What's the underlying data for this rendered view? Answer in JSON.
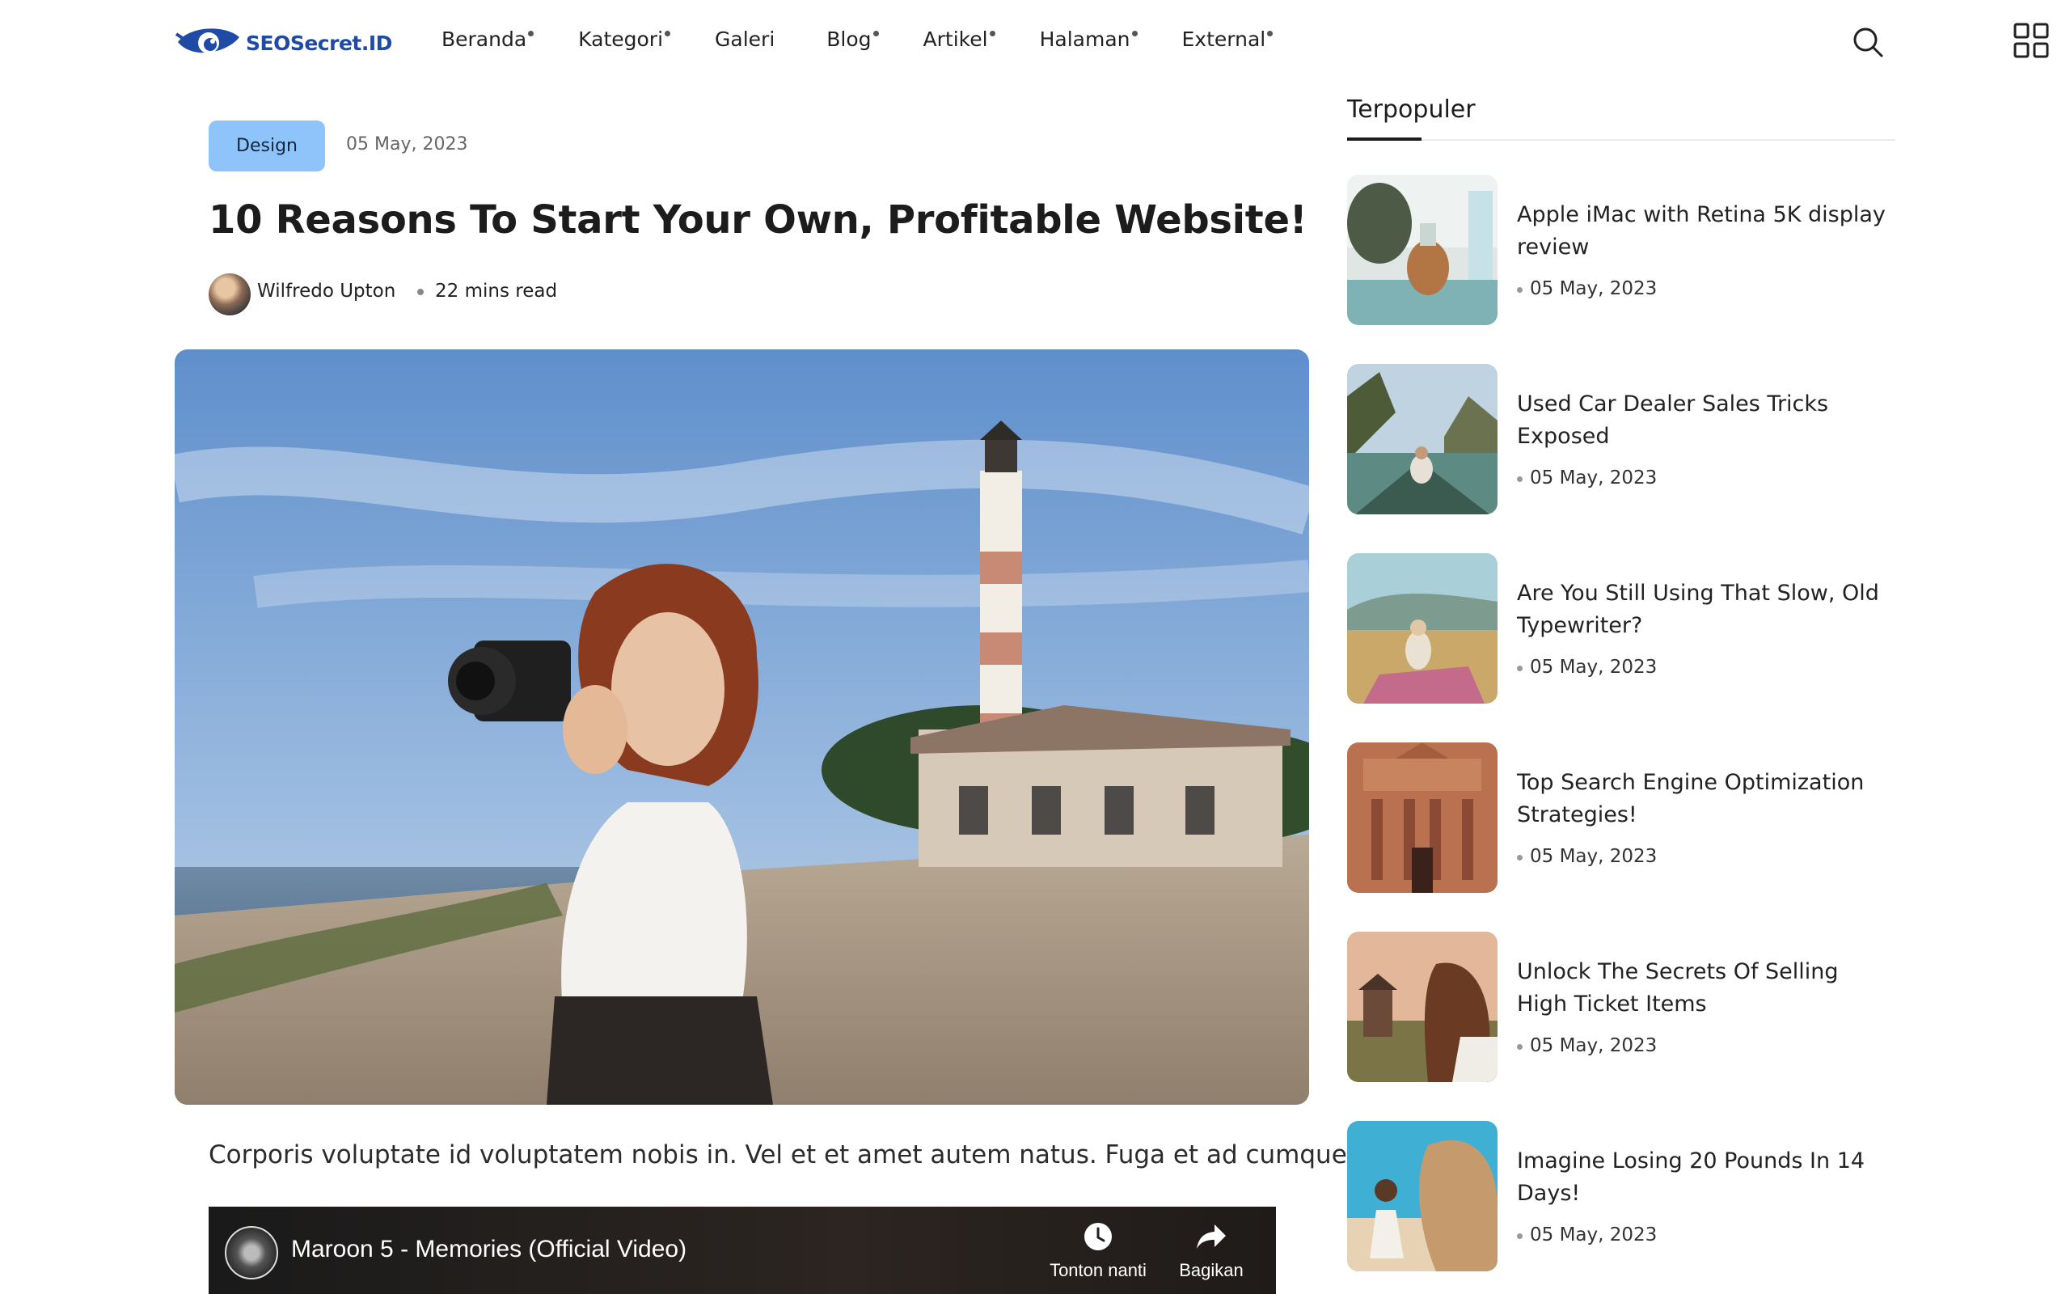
{
  "header": {
    "logo_text": "SEOSecret.ID",
    "nav": [
      {
        "label": "Beranda",
        "has_submenu": true
      },
      {
        "label": "Kategori",
        "has_submenu": true
      },
      {
        "label": "Galeri",
        "has_submenu": false
      },
      {
        "label": "Blog",
        "has_submenu": true
      },
      {
        "label": "Artikel",
        "has_submenu": true
      },
      {
        "label": "Halaman",
        "has_submenu": true
      },
      {
        "label": "External",
        "has_submenu": true
      }
    ],
    "icons": {
      "search": "search-icon",
      "menu": "grid-menu-icon"
    }
  },
  "article": {
    "category": "Design",
    "date": "05 May, 2023",
    "title": "10 Reasons To Start Your Own, Profitable Website!",
    "author": "Wilfredo Upton",
    "read_time": "22 mins read",
    "excerpt": "Corporis voluptate id voluptatem nobis in. Vel et et amet autem natus. Fuga et ad cumque.",
    "video": {
      "title": "Maroon 5 - Memories (Official Video)",
      "watch_later": "Tonton nanti",
      "share": "Bagikan"
    }
  },
  "sidebar": {
    "heading": "Terpopuler",
    "items": [
      {
        "title": "Apple iMac with Retina 5K display review",
        "date": "05 May, 2023"
      },
      {
        "title": "Used Car Dealer Sales Tricks Exposed",
        "date": "05 May, 2023"
      },
      {
        "title": "Are You Still Using That Slow, Old Typewriter?",
        "date": "05 May, 2023"
      },
      {
        "title": "Top Search Engine Optimization Strategies!",
        "date": "05 May, 2023"
      },
      {
        "title": "Unlock The Secrets Of Selling High Ticket Items",
        "date": "05 May, 2023"
      },
      {
        "title": "Imagine Losing 20 Pounds In 14 Days!",
        "date": "05 May, 2023"
      }
    ]
  },
  "colors": {
    "brand": "#1f4aa5",
    "badge": "#8ec4f9",
    "text": "#222222"
  }
}
